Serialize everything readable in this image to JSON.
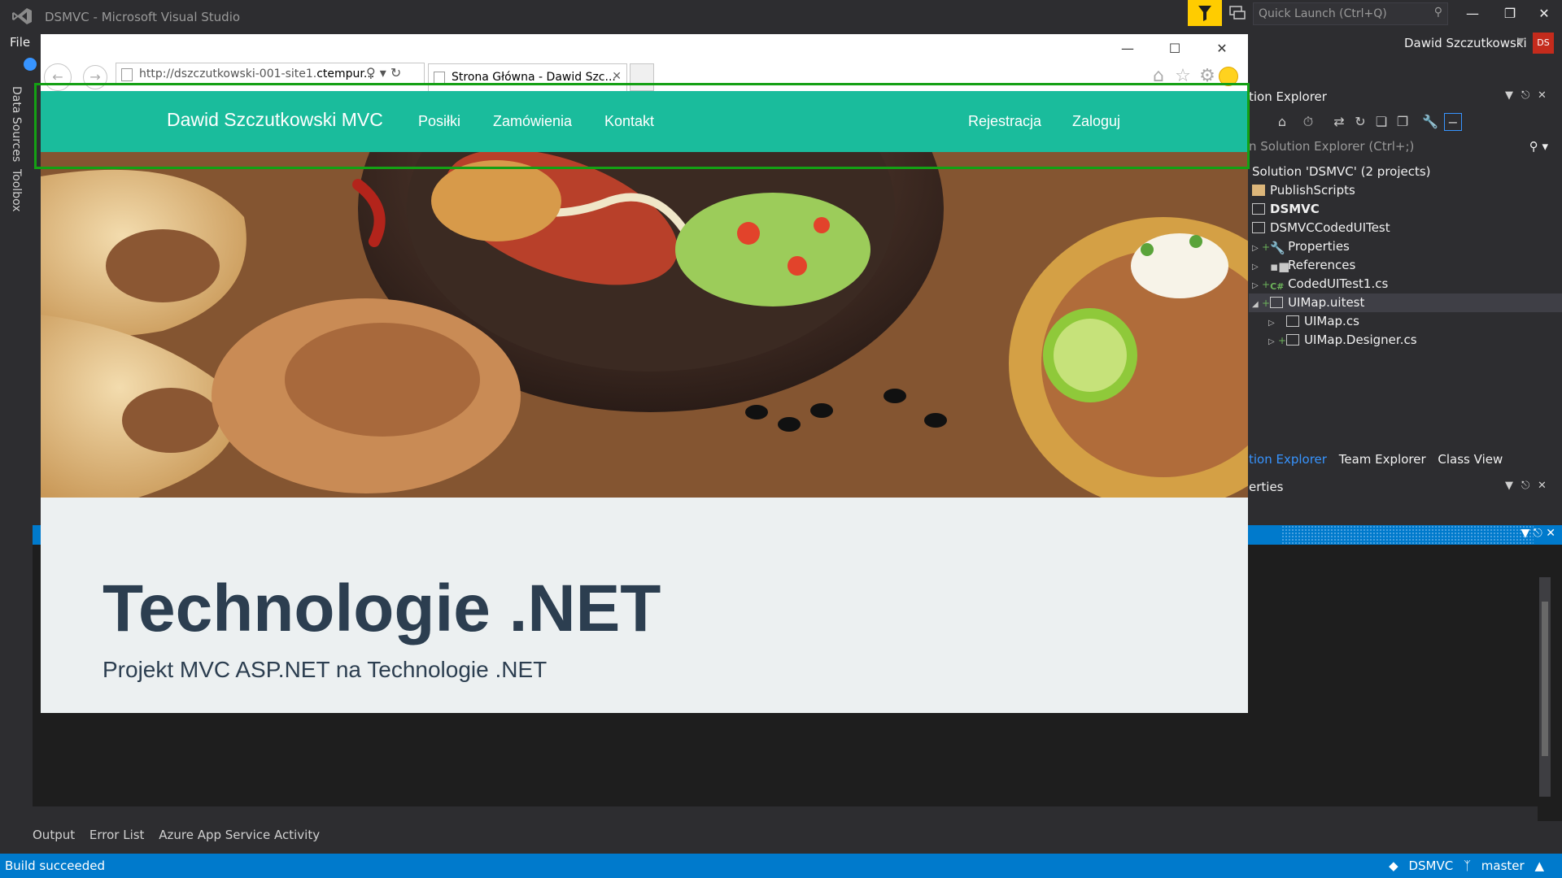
{
  "vs": {
    "window_title": "DSMVC - Microsoft Visual Studio",
    "quick_launch_placeholder": "Quick Launch (Ctrl+Q)",
    "user_name": "Dawid Szczutkowski",
    "user_initials": "DS",
    "menu_file": "File",
    "left_dock_tabs": [
      "Data Sources",
      "Toolbox"
    ]
  },
  "solution_explorer": {
    "header": "tion Explorer",
    "search_placeholder": "n Solution Explorer (Ctrl+;)",
    "items": [
      {
        "label": "Solution 'DSMVC' (2 projects)"
      },
      {
        "label": "PublishScripts"
      },
      {
        "label": "DSMVC"
      },
      {
        "label": "DSMVCCodedUITest"
      },
      {
        "label": "Properties"
      },
      {
        "label": "References"
      },
      {
        "label": "CodedUITest1.cs"
      },
      {
        "label": "UIMap.uitest"
      },
      {
        "label": "UIMap.cs"
      },
      {
        "label": "UIMap.Designer.cs"
      }
    ],
    "tabs": [
      "tion Explorer",
      "Team Explorer",
      "Class View"
    ]
  },
  "properties": {
    "header": "erties"
  },
  "bottom_tabs": [
    "Output",
    "Error List",
    "Azure App Service Activity"
  ],
  "statusbar": {
    "text": "Build succeeded",
    "repo": "DSMVC",
    "branch": "master"
  },
  "browser": {
    "address": "http://dszczutkowski-001-site1.",
    "address_host": "ctempur...",
    "tab_title": "Strona Główna - Dawid Szc..."
  },
  "site": {
    "brand": "Dawid Szczutkowski MVC",
    "nav_links": [
      "Posiłki",
      "Zamówienia",
      "Kontakt"
    ],
    "nav_right": [
      "Rejestracja",
      "Zaloguj"
    ],
    "jumbo_title": "Technologie .NET",
    "jumbo_subtitle": "Projekt MVC ASP.NET na Technologie .NET"
  },
  "colors": {
    "vs_background": "#2d2d30",
    "vs_accent": "#007acc",
    "site_navbar": "#1abc9c",
    "jumbotron_bg": "#ecf0f1",
    "jumbotron_text": "#2c3e50",
    "highlight": "#14a014"
  }
}
